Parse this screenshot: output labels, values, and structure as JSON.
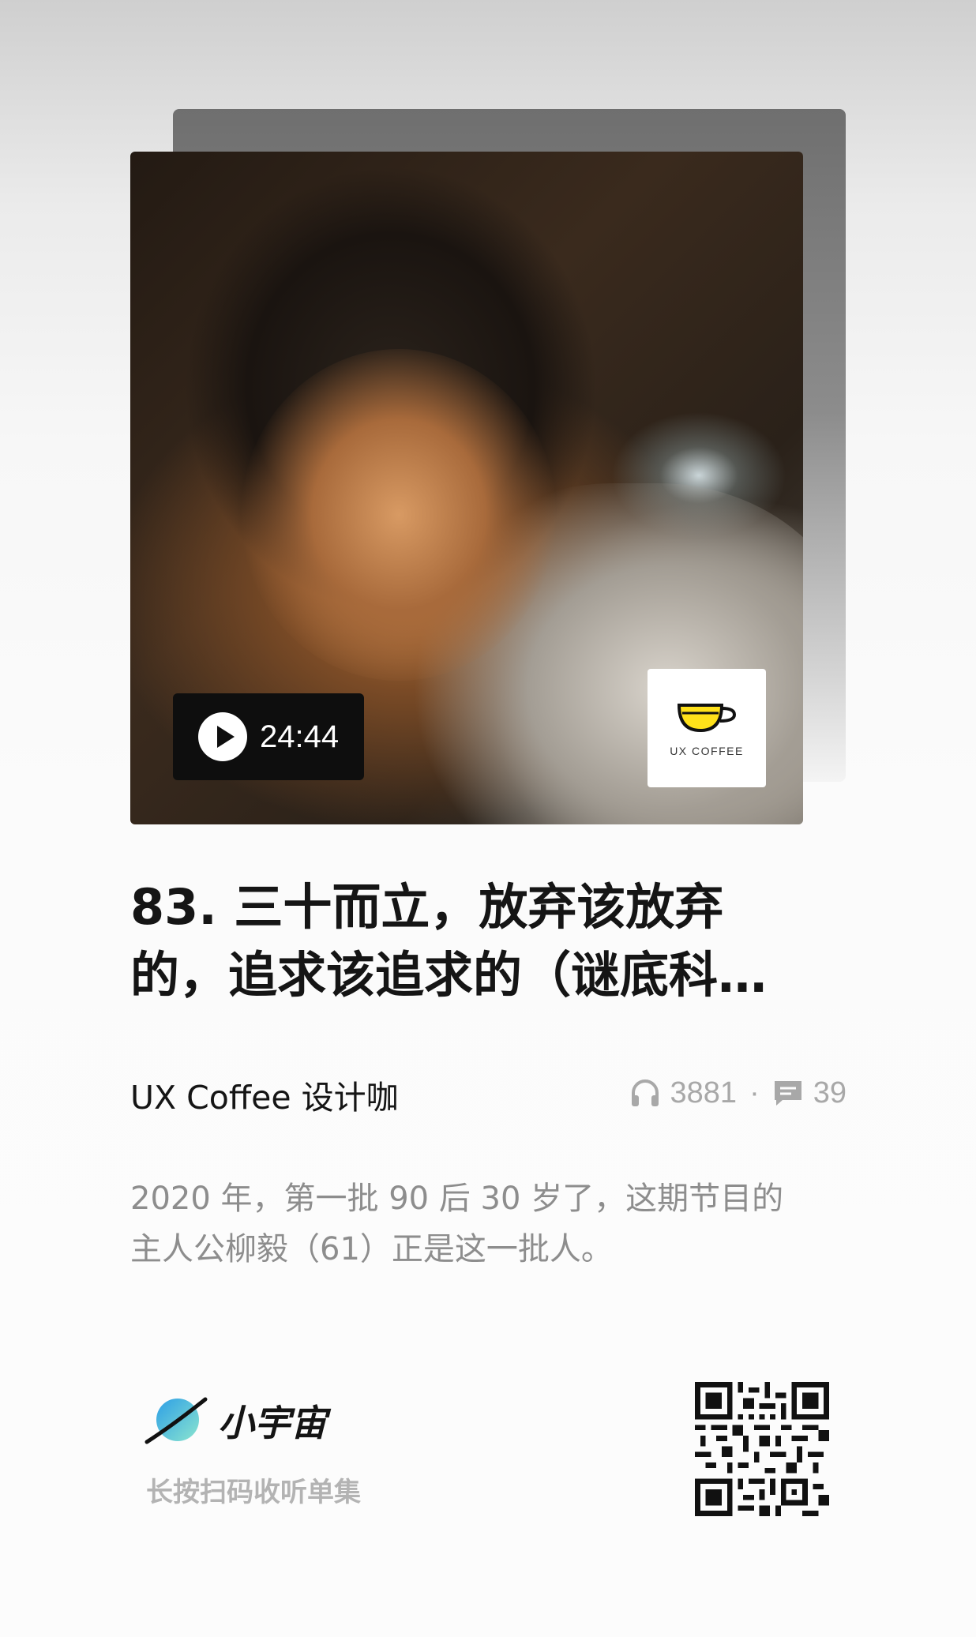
{
  "episode": {
    "duration": "24:44",
    "title_line_1": "83. 三十而立，放弃该放弃",
    "title_line_2": "的，追求该追求的（谜底科…",
    "podcast_name": "UX Coffee 设计咖",
    "play_count": "3881",
    "comment_count": "39",
    "stats_separator": "·",
    "description": "2020 年，第一批 90 后 30 岁了，这期节目的主人公柳毅（61）正是这一批人。"
  },
  "cover_logo": {
    "text": "UX COFFEE",
    "cup_color": "#ffe11a"
  },
  "footer": {
    "brand_name": "小宇宙",
    "scan_hint": "长按扫码收听单集"
  },
  "icons": {
    "play": "play-icon",
    "headphones": "headphones-icon",
    "comment": "comment-icon",
    "planet": "planet-logo-icon"
  },
  "colors": {
    "title": "#151515",
    "secondary_text": "#8d8d8d",
    "stats_text": "#a8a8a8",
    "badge_bg": "#0e0e0e",
    "brand_gradient_start": "#3fb0e6",
    "brand_gradient_end": "#7fe0c8"
  }
}
